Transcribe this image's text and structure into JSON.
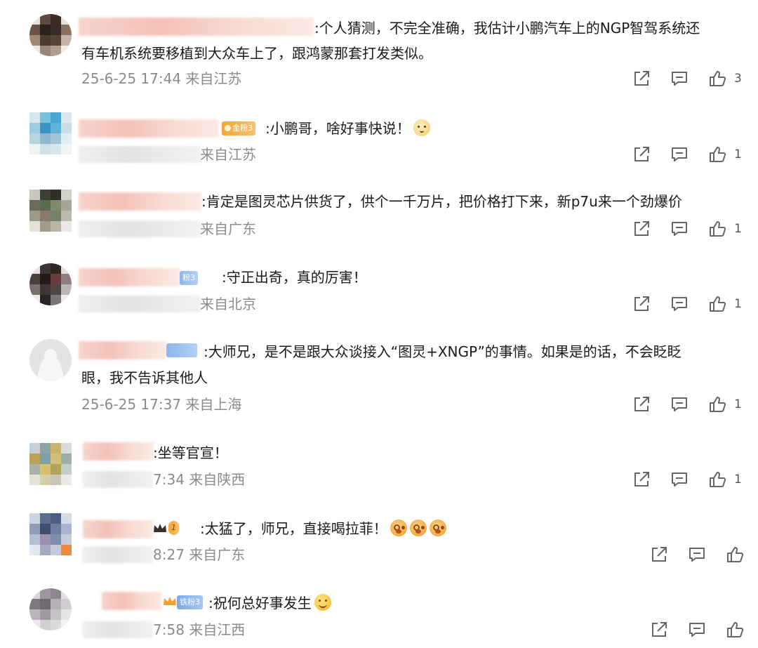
{
  "comments": [
    {
      "text_line1": ":个人猜测，不完全准确，我估计小鹏汽车上的NGP智驾系统还",
      "text_line2": "有车机系统要移植到大众车上了，跟鸿蒙那套打发类似。",
      "meta": "25-6-25 17:44 来自江苏",
      "likes": "3"
    },
    {
      "badge": "金粉3",
      "text_line1": ":小鹏哥，啥好事快说！",
      "meta": "来自江苏",
      "likes": "1"
    },
    {
      "text_line1": ":肯定是图灵芯片供货了，供个一千万片，把价格打下来，新p7u来一个劲爆价",
      "meta": "来自广东",
      "likes": "1"
    },
    {
      "badge": "粉3",
      "text_line1": ":守正出奇，真的厉害！",
      "meta": "来自北京",
      "likes": "1"
    },
    {
      "text_line1": ":大师兄，是不是跟大众谈接入“图灵+XNGP”的事情。如果是的话，不会眨眨",
      "text_line2": "眼，我不告诉其他人",
      "meta": "25-6-25 17:37 来自上海",
      "likes": "1"
    },
    {
      "text_line1": ":坐等官宣！",
      "meta": "7:34 来自陕西",
      "likes": "1"
    },
    {
      "badge": "1",
      "text_line1": ":太猛了，师兄，直接喝拉菲！",
      "meta": "8:27 来自广东",
      "likes": ""
    },
    {
      "badge": "铁粉3",
      "text_line1": ":祝何总好事发生",
      "meta": "7:58 来自江西",
      "likes": ""
    }
  ],
  "icons": {
    "share": "share-icon",
    "comment": "comment-icon",
    "like": "thumbs-up-icon",
    "emoji_cat": "cat-face-emoji-icon",
    "emoji_wah": "wah-emoji-icon",
    "emoji_smile": "smile-emoji-icon"
  },
  "colors": {
    "text": "#1a1a1a",
    "meta": "#8b8b8b",
    "icon": "#666666",
    "gold_badge": "#f3a53c",
    "blue_badge": "#8db6ec"
  }
}
